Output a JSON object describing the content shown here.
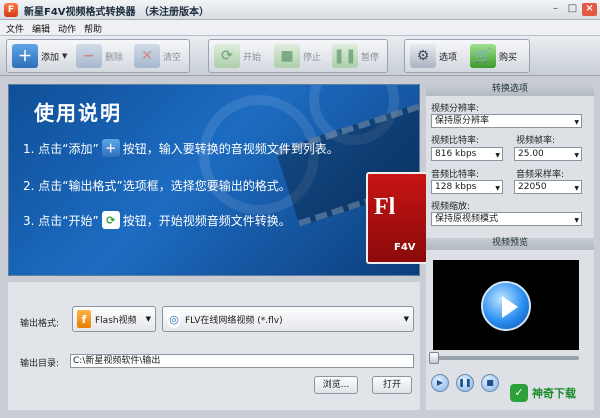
{
  "window": {
    "title": "新星F4V视频格式转换器 （未注册版本）",
    "icon_name": "app-logo-icon"
  },
  "menu": [
    "文件",
    "编辑",
    "动作",
    "帮助"
  ],
  "toolbar": {
    "add": "添加",
    "delete": "删除",
    "clear": "清空",
    "start": "开始",
    "stop": "停止",
    "pause": "暂停",
    "options": "选项",
    "buy": "购买"
  },
  "banner": {
    "title": "使用说明",
    "step1_a": "1. 点击“添加”",
    "step1_b": "按钮，输入要转换的音视频文件到列表。",
    "step2": "2. 点击“输出格式”选项框，选择您要输出的格式。",
    "step3_a": "3. 点击“开始”",
    "step3_b": "按钮，开始视频音频文件转换。",
    "flv_big": "Fl",
    "flv_small": "F4V"
  },
  "output": {
    "format_label": "输出格式:",
    "format_category": "Flash视频",
    "format_value": "FLV在线网络视频 (*.flv)",
    "dir_label": "输出目录:",
    "dir_value": "C:\\新星视频软件\\输出",
    "browse": "浏览...",
    "open": "打开"
  },
  "settings": {
    "header": "转换选项",
    "resolution_label": "视频分辨率:",
    "resolution_value": "保持原分辨率",
    "video_bitrate_label": "视频比特率:",
    "video_bitrate_value": "816 kbps",
    "framerate_label": "视频帧率:",
    "framerate_value": "25.00",
    "audio_bitrate_label": "音频比特率:",
    "audio_bitrate_value": "128 kbps",
    "samplerate_label": "音频采样率:",
    "samplerate_value": "22050",
    "scale_label": "视频缩放:",
    "scale_value": "保持原视频模式"
  },
  "preview": {
    "header": "视频预览"
  },
  "watermark": {
    "text": "神奇下载"
  },
  "colors": {
    "banner_blue": "#1d6cc2",
    "accent_green": "#2ea03a",
    "flv_red": "#c81414"
  }
}
